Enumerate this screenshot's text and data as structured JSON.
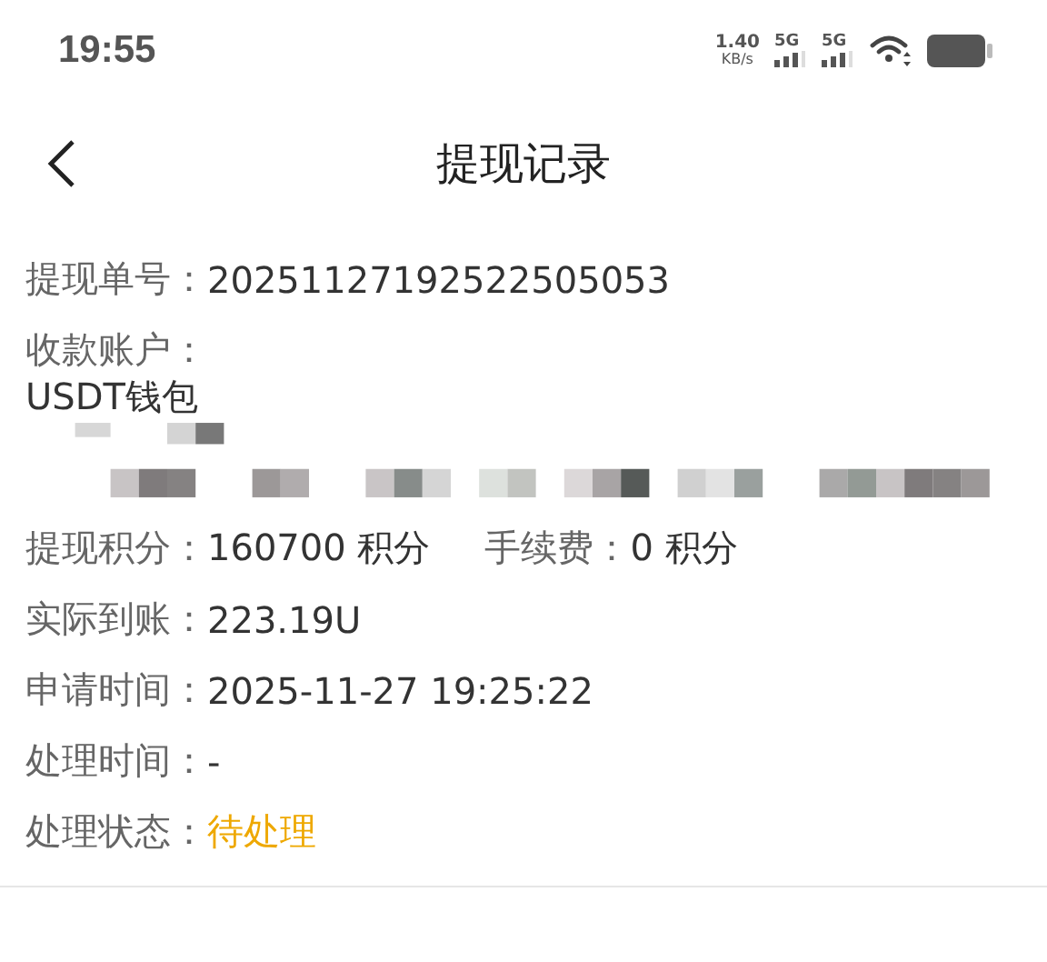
{
  "status_bar": {
    "time": "19:55",
    "net_speed": "1.40",
    "net_unit": "KB/s",
    "sims": [
      "5G",
      "5G"
    ]
  },
  "header": {
    "title": "提现记录"
  },
  "records": [
    {
      "rows": [
        {
          "kind": "plain",
          "items": [
            {
              "label": "提现单号：",
              "value": "20251127192522505053"
            }
          ]
        },
        {
          "kind": "account",
          "items": [
            {
              "label": "收款账户：",
              "value": "USDT钱包"
            }
          ]
        },
        {
          "kind": "plain",
          "items": [
            {
              "label": "提现积分：",
              "value": "160700 积分"
            },
            {
              "label": "手续费：",
              "value": "0 积分"
            }
          ]
        },
        {
          "kind": "plain",
          "items": [
            {
              "label": "实际到账：",
              "value": "223.19U"
            }
          ]
        },
        {
          "kind": "plain",
          "items": [
            {
              "label": "申请时间：",
              "value": "2025-11-27 19:25:22"
            }
          ]
        },
        {
          "kind": "plain",
          "items": [
            {
              "label": "处理时间：",
              "value": "-"
            }
          ]
        },
        {
          "kind": "status",
          "items": [
            {
              "label": "处理状态：",
              "value": "待处理"
            }
          ]
        }
      ]
    }
  ]
}
